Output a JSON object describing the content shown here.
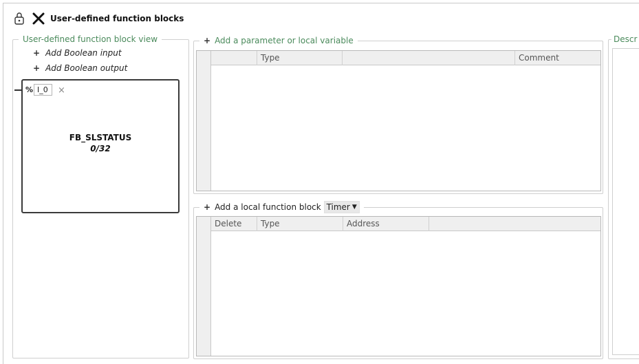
{
  "header": {
    "lock_icon": "lock-icon",
    "close_icon": "close-icon",
    "title": "User-defined function blocks"
  },
  "fb_view": {
    "legend": "User-defined function block view",
    "add_input": "Add Boolean input",
    "add_output": "Add Boolean output",
    "pin_prefix": "%",
    "pin_value": "I_0",
    "remove_glyph": "×",
    "block_name": "FB_SLSTATUS",
    "block_count": "0/32"
  },
  "params": {
    "legend": "Add a parameter or local variable",
    "columns": [
      "",
      "Type",
      "",
      "Comment"
    ]
  },
  "local_fb": {
    "legend": "Add a local function block",
    "dropdown_value": "Timer",
    "columns": [
      "Delete",
      "Type",
      "Address"
    ]
  },
  "description": {
    "legend": "Descr"
  }
}
